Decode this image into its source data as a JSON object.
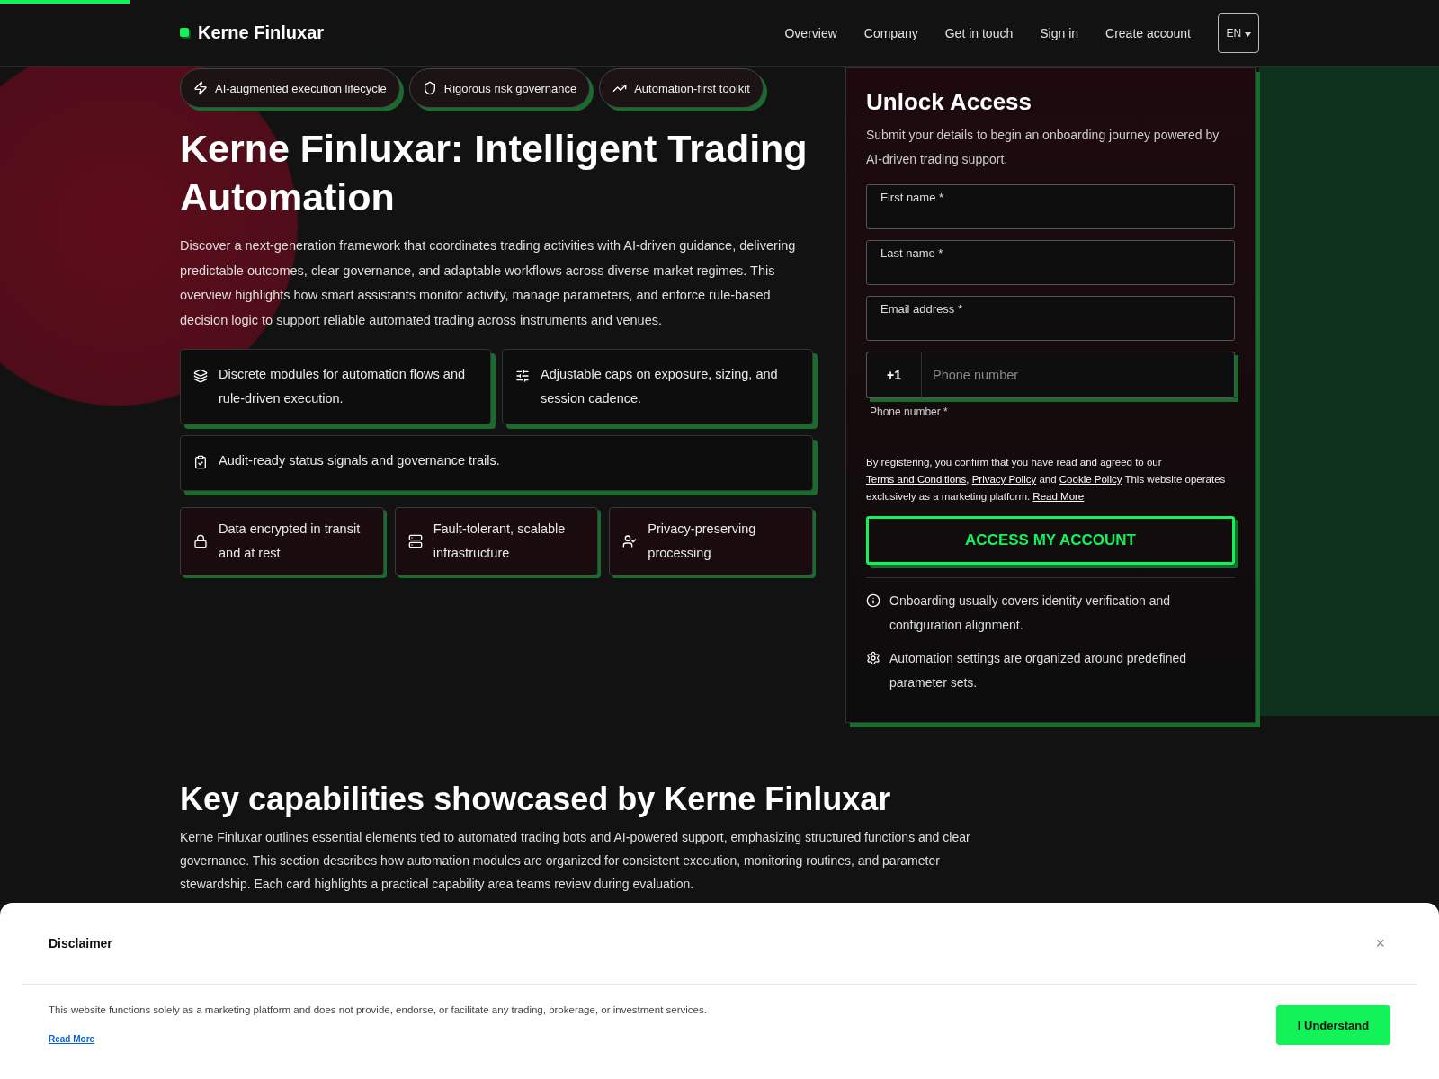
{
  "progress": {
    "level": 0.09
  },
  "header": {
    "logo": "Kerne Finluxar",
    "nav": [
      {
        "label": "Overview"
      },
      {
        "label": "Company"
      },
      {
        "label": "Get in touch"
      },
      {
        "label": "Sign in"
      },
      {
        "label": "Create account"
      }
    ],
    "language": "EN"
  },
  "hero": {
    "badges": [
      {
        "label": "AI-augmented execution lifecycle"
      },
      {
        "label": "Rigorous risk governance"
      },
      {
        "label": "Automation-first toolkit"
      }
    ],
    "title": "Kerne Finluxar: Intelligent Trading Automation",
    "description": "Discover a next-generation framework that coordinates trading activities with AI-driven guidance, delivering predictable outcomes, clear governance, and adaptable workflows across diverse market regimes. This overview highlights how smart assistants monitor activity, manage parameters, and enforce rule-based decision logic to support reliable automated trading across instruments and venues.",
    "features": [
      {
        "text": "Discrete modules for automation flows and rule-driven execution."
      },
      {
        "text": "Adjustable caps on exposure, sizing, and session cadence."
      },
      {
        "text": "Audit-ready status signals and governance trails."
      }
    ],
    "highlights": [
      {
        "text": "Data encrypted in transit and at rest"
      },
      {
        "text": "Fault-tolerant, scalable infrastructure"
      },
      {
        "text": "Privacy-preserving processing"
      }
    ]
  },
  "form": {
    "title": "Unlock Access",
    "subtitle": "Submit your details to begin an onboarding journey powered by AI-driven trading support.",
    "fields": [
      {
        "label": "First name *"
      },
      {
        "label": "Last name *"
      },
      {
        "label": "Email address *"
      }
    ],
    "phone": {
      "code": "+1",
      "placeholder": "Phone number",
      "label": "Phone number *"
    },
    "consent": [
      {
        "kind": "text",
        "text": "By registering, you confirm that you have read and agreed to our "
      },
      {
        "kind": "link",
        "text": "Terms and Conditions"
      },
      {
        "kind": "text",
        "text": ", "
      },
      {
        "kind": "link",
        "text": "Privacy Policy"
      },
      {
        "kind": "text",
        "text": " and "
      },
      {
        "kind": "link",
        "text": "Cookie Policy"
      },
      {
        "kind": "text",
        "text": " This website operates exclusively as a marketing platform. "
      },
      {
        "kind": "link",
        "text": "Read More"
      }
    ],
    "submit": "ACCESS MY ACCOUNT",
    "notes": [
      {
        "text": "Onboarding usually covers identity verification and configuration alignment."
      },
      {
        "text": "Automation settings are organized around predefined parameter sets."
      }
    ]
  },
  "capabilities": {
    "title": "Key capabilities showcased by Kerne Finluxar",
    "description": "Kerne Finluxar outlines essential elements tied to automated trading bots and AI-powered support, emphasizing structured functions and clear governance. This section describes how automation modules are organized for consistent execution, monitoring routines, and parameter stewardship. Each card highlights a practical capability area teams review during evaluation."
  },
  "disclaimer": {
    "title": "Disclaimer",
    "close": "×",
    "text": "This website functions solely as a marketing platform and does not provide, endorse, or facilitate any trading, brokerage, or investment services.",
    "link": "Read More",
    "button": "I Understand"
  }
}
